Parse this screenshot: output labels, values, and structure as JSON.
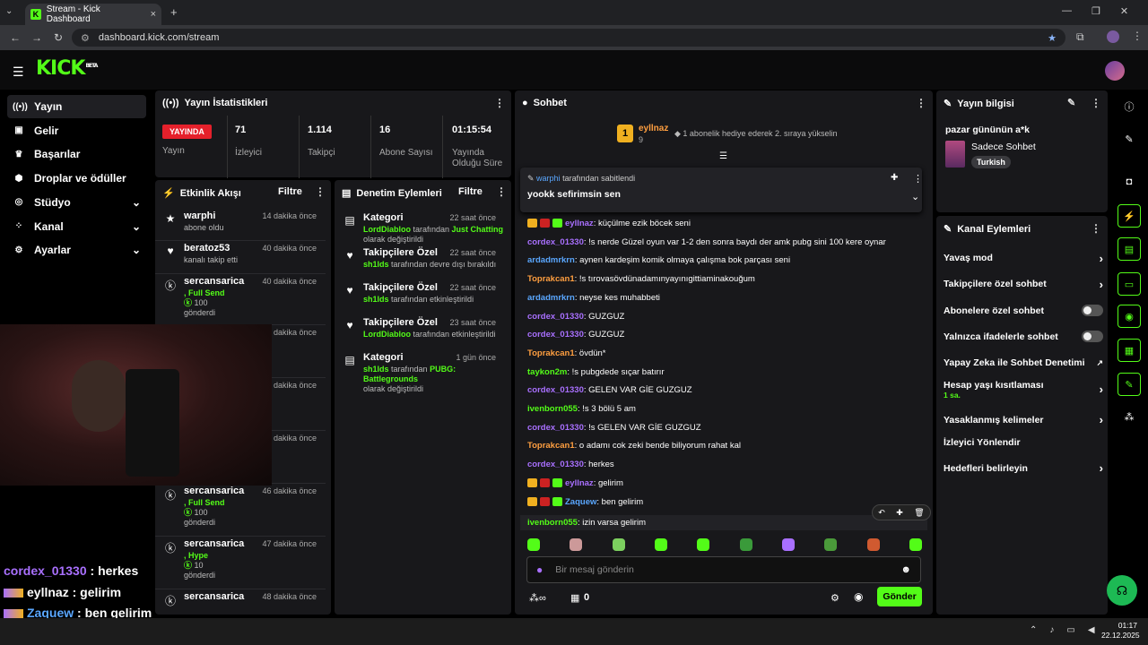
{
  "browser": {
    "tab_title": "Stream - Kick Dashboard",
    "url": "dashboard.kick.com/stream"
  },
  "header": {
    "logo": "KICK",
    "logo_sup": "BETA"
  },
  "sidebar": {
    "items": [
      {
        "label": "Yayın",
        "icon": "broadcast-icon",
        "active": true
      },
      {
        "label": "Gelir",
        "icon": "money-icon"
      },
      {
        "label": "Başarılar",
        "icon": "trophy-icon"
      },
      {
        "label": "Droplar ve ödüller",
        "icon": "gift-icon"
      },
      {
        "label": "Stüdyo",
        "icon": "studio-icon",
        "chev": true
      },
      {
        "label": "Kanal",
        "icon": "channel-icon",
        "chev": true
      },
      {
        "label": "Ayarlar",
        "icon": "gear-icon",
        "chev": true
      }
    ]
  },
  "stats": {
    "title": "Yayın İstatistikleri",
    "live": "YAYINDA",
    "live_label": "Yayın",
    "items": [
      {
        "v": "71",
        "l": "İzleyici"
      },
      {
        "v": "1.114",
        "l": "Takipçi"
      },
      {
        "v": "16",
        "l": "Abone Sayısı"
      },
      {
        "v": "01:15:54",
        "l": "Yayında Olduğu Süre"
      }
    ]
  },
  "activity": {
    "title": "Etkinlik Akışı",
    "filter": "Filtre",
    "items": [
      {
        "name": "warphi",
        "sub": "abone oldu",
        "time": "14 dakika önce"
      },
      {
        "name": "beratoz53",
        "sub": "kanalı takip etti",
        "time": "40 dakika önce"
      },
      {
        "name": "sercansarica",
        "sub1": ", Full Send",
        "sub2": "100",
        "sub3": "gönderdi",
        "time": "40 dakika önce"
      },
      {
        "time": "42 dakika önce"
      },
      {
        "time": "45 dakika önce"
      },
      {
        "time": "46 dakika önce"
      },
      {
        "name": "sercansarica",
        "sub1": ", Full Send",
        "sub2": "100",
        "sub3": "gönderdi",
        "time": "46 dakika önce"
      },
      {
        "name": "sercansarica",
        "sub1": ", Hype",
        "sub2": "10",
        "sub3": "gönderdi",
        "time": "47 dakika önce"
      },
      {
        "name": "sercansarica",
        "time": "48 dakika önce"
      }
    ]
  },
  "moderation": {
    "title": "Denetim Eylemleri",
    "filter": "Filtre",
    "items": [
      {
        "name": "Kategori",
        "user": "LordDiabloo",
        "mid": " tarafından ",
        "extra": "Just Chatting",
        "rest": "olarak değiştirildi",
        "time": "22 saat önce"
      },
      {
        "name": "Takipçilere Özel",
        "user": "sh1lds",
        "mid": " tarafından devre dışı bırakıldı",
        "extra": "",
        "rest": "",
        "time": "22 saat önce"
      },
      {
        "name": "Takipçilere Özel",
        "user": "sh1lds",
        "mid": " tarafından etkinleştirildi",
        "extra": "",
        "rest": "",
        "time": "22 saat önce"
      },
      {
        "name": "Takipçilere Özel",
        "user": "LordDiabloo",
        "mid": " tarafından etkinleştirildi",
        "extra": "",
        "rest": "",
        "time": "23 saat önce"
      },
      {
        "name": "Kategori",
        "user": "sh1lds",
        "mid": " tarafından ",
        "extra": "PUBG: Battlegrounds",
        "rest": "olarak değiştirildi",
        "time": "1 gün önce"
      }
    ]
  },
  "chat": {
    "title": "Sohbet",
    "top_user": "eyllnaz",
    "top_rank": "1",
    "top_count": "9",
    "top_note": "1 abonelik hediye ederek 2. sıraya yükselin",
    "pinned_by": "warphi",
    "pinned_by_suffix": " tarafından sabitlendi",
    "pinned_msg": "yookk sefirimsin sen",
    "messages": [
      {
        "user": "eyllnaz",
        "color": "purple",
        "text": "küçülme ezik böcek seni",
        "badges": true
      },
      {
        "user": "cordex_01330",
        "color": "purple",
        "text": "!s nerde Güzel oyun var 1-2 den sonra baydı der amk pubg sini 100 kere oynar"
      },
      {
        "user": "ardadmrkrn",
        "color": "blue",
        "text": "aynen kardeşim komik olmaya çalışma bok parçası seni"
      },
      {
        "user": "Toprakcan1",
        "color": "orange",
        "text": "!s tırovasövdünadamınyayınıgittiaminakouğum"
      },
      {
        "user": "ardadmrkrn",
        "color": "blue",
        "text": "neyse kes muhabbeti"
      },
      {
        "user": "cordex_01330",
        "color": "purple",
        "text": "GUZGUZ"
      },
      {
        "user": "cordex_01330",
        "color": "purple",
        "text": "GUZGUZ"
      },
      {
        "user": "Toprakcan1",
        "color": "orange",
        "text": "övdün*"
      },
      {
        "user": "taykon2m",
        "color": "lgreen",
        "text": "!s pubgdede sıçar batırır"
      },
      {
        "user": "cordex_01330",
        "color": "purple",
        "text": "GELEN VAR GİE GUZGUZ"
      },
      {
        "user": "ivenborn055",
        "color": "lgreen",
        "text": "!s 3 bölü 5 am"
      },
      {
        "user": "cordex_01330",
        "color": "purple",
        "text": "!s GELEN VAR GİE GUZGUZ"
      },
      {
        "user": "Toprakcan1",
        "color": "orange",
        "text": "o adamı cok zeki bende biliyorum rahat kal"
      },
      {
        "user": "cordex_01330",
        "color": "purple",
        "text": "herkes"
      },
      {
        "user": "eyllnaz",
        "color": "purple",
        "text": "gelirim",
        "badges": true
      },
      {
        "user": "Zaquew",
        "color": "blue",
        "text": "ben gelirim",
        "badges": true
      },
      {
        "user": "ivenborn055",
        "color": "lgreen",
        "text": "izin varsa gelirim"
      }
    ],
    "input_placeholder": "Bir mesaj gönderin",
    "points": "0",
    "send": "Gönder"
  },
  "stream_info": {
    "title": "Yayın bilgisi",
    "stream_title": "pazar gününün a*k",
    "category": "Sadece Sohbet",
    "tag": "Turkish"
  },
  "channel_actions": {
    "title": "Kanal Eylemleri",
    "items": [
      {
        "label": "Yavaş mod",
        "type": "chev"
      },
      {
        "label": "Takipçilere özel sohbet",
        "type": "chev"
      },
      {
        "label": "Abonelere özel sohbet",
        "type": "toggle"
      },
      {
        "label": "Yalnızca ifadelerle sohbet",
        "type": "toggle"
      },
      {
        "label": "Yapay Zeka ile Sohbet Denetimi",
        "type": "ext"
      },
      {
        "label": "Hesap yaşı kısıtlaması",
        "sub": "1 sa.",
        "type": "chev"
      },
      {
        "label": "Yasaklanmış kelimeler",
        "type": "chev"
      },
      {
        "label": "İzleyici Yönlendir",
        "type": "none"
      },
      {
        "label": "Hedefleri belirleyin",
        "type": "chev"
      }
    ]
  },
  "overlay": [
    {
      "user": "cordex_01330",
      "text": " : herkes",
      "color": "#a970ff"
    },
    {
      "user": "eyllnaz",
      "text": " : gelirim",
      "color": "#ffffff"
    },
    {
      "user": "Zaquew",
      "text": " : ben gelirim",
      "color": "#5aa7ff"
    },
    {
      "user": "ivenborn055",
      "text": " : izin varsa gelirim",
      "color": "#53fc18"
    }
  ],
  "taskbar": {
    "time": "01:17",
    "date": "22.12.2025"
  }
}
